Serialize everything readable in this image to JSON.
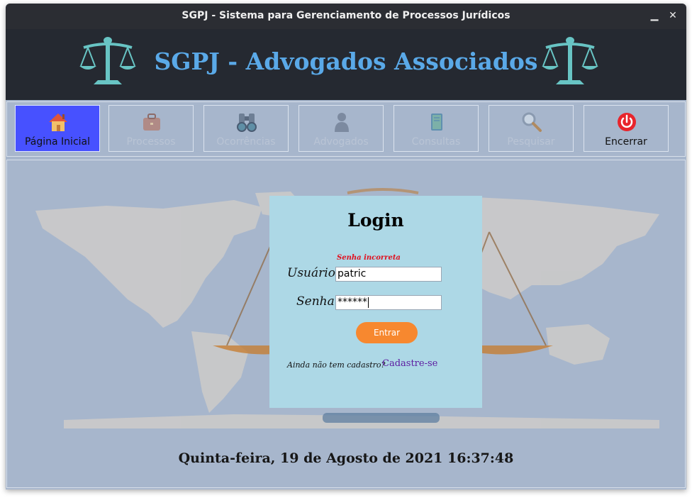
{
  "window": {
    "title": "SGPJ - Sistema para Gerenciamento de Processos Jurídicos",
    "minimize_label": "▁",
    "close_label": "✕"
  },
  "banner": {
    "title": "SGPJ - Advogados Associados",
    "title_color": "#5aa9e8",
    "left_icon": "scales-of-justice-icon",
    "right_icon": "scales-of-justice-icon"
  },
  "toolbar": {
    "items": [
      {
        "label": "Página Inicial",
        "icon": "home-icon",
        "state": "active"
      },
      {
        "label": "Processos",
        "icon": "briefcase-icon",
        "state": "disabled"
      },
      {
        "label": "Ocorrências",
        "icon": "binoculars-icon",
        "state": "disabled"
      },
      {
        "label": "Advogados",
        "icon": "person-icon",
        "state": "disabled"
      },
      {
        "label": "Consultas",
        "icon": "book-icon",
        "state": "disabled"
      },
      {
        "label": "Pesquisar",
        "icon": "magnifier-icon",
        "state": "disabled"
      },
      {
        "label": "Encerrar",
        "icon": "power-icon",
        "state": "enabled"
      }
    ],
    "active_color": "#4751ff"
  },
  "login": {
    "title": "Login",
    "error": "Senha incorreta",
    "user_label": "Usuário",
    "user_value": "patric",
    "password_label": "Senha",
    "password_value": "******",
    "submit_label": "Entrar",
    "signup_question": "Ainda não tem cadastro?",
    "signup_link": "Cadastre-se",
    "submit_color": "#f7882f",
    "panel_color": "#add8e6"
  },
  "footer": {
    "datetime": "Quinta-feira, 19 de Agosto de 2021 16:37:48"
  }
}
